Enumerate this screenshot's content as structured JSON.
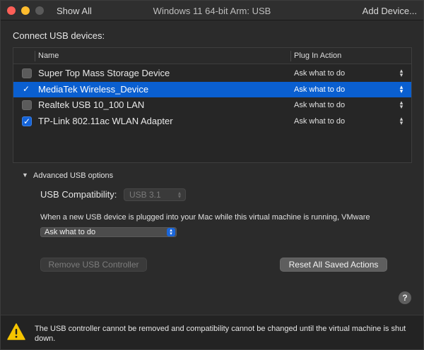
{
  "titlebar": {
    "show_all": "Show All",
    "title": "Windows 11 64-bit Arm: USB",
    "add_device": "Add Device..."
  },
  "connect_label": "Connect USB devices:",
  "table": {
    "headers": {
      "name": "Name",
      "action": "Plug In Action"
    },
    "rows": [
      {
        "name": "Super Top Mass Storage Device",
        "action": "Ask what to do",
        "checked": false,
        "selected": false
      },
      {
        "name": "MediaTek Wireless_Device",
        "action": "Ask what to do",
        "checked": true,
        "selected": true
      },
      {
        "name": "Realtek USB 10_100 LAN",
        "action": "Ask what to do",
        "checked": false,
        "selected": false
      },
      {
        "name": "TP-Link 802.11ac WLAN Adapter",
        "action": "Ask what to do",
        "checked": true,
        "selected": false
      }
    ]
  },
  "advanced": {
    "label": "Advanced USB options",
    "compat_label": "USB Compatibility:",
    "compat_value": "USB 3.1",
    "description": "When a new USB device is plugged into your Mac while this virtual machine is running, VMware",
    "action_value": "Ask what to do",
    "remove_button": "Remove USB Controller",
    "reset_button": "Reset All Saved Actions"
  },
  "help_label": "?",
  "footer": {
    "warning": "The USB controller cannot be removed and compatibility cannot be changed until the virtual machine is shut down."
  },
  "colors": {
    "selection": "#0a5fd0",
    "checkbox_checked": "#1463d8",
    "warning_yellow": "#f5c400"
  }
}
